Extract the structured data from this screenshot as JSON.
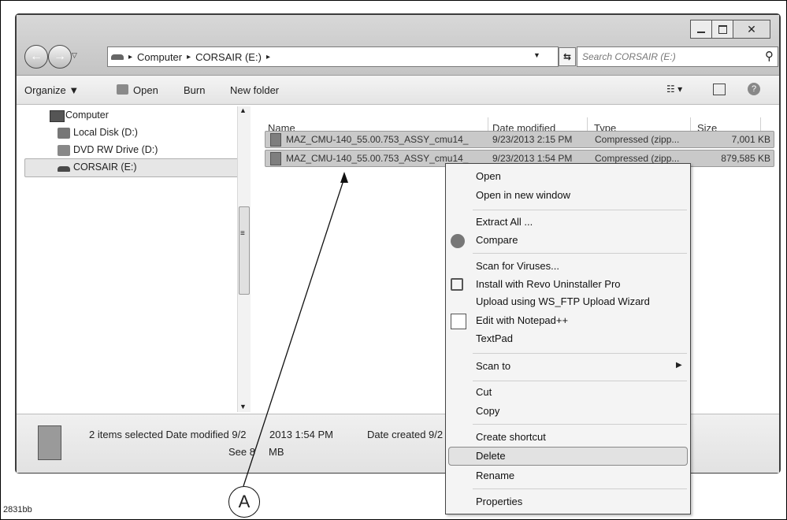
{
  "address": {
    "crumbs": [
      "Computer",
      "CORSAIR (E:)"
    ],
    "separators": [
      "▸",
      "▸",
      "▸"
    ]
  },
  "search": {
    "placeholder": "Search CORSAIR (E:)"
  },
  "toolbar": {
    "organize_label": "Organize ▼",
    "open_label": "Open",
    "burn_label": "Burn",
    "new_folder_label": "New folder"
  },
  "nav": {
    "items": [
      {
        "label": "Computer",
        "icon": "computer-icon"
      },
      {
        "label": "Local Disk  (D:)",
        "icon": "local-disk-icon"
      },
      {
        "label": "DVD RW Drive (D:)",
        "icon": "dvd-drive-icon"
      },
      {
        "label": "CORSAIR  (E:)",
        "icon": "usb-drive-icon",
        "selected": true
      }
    ]
  },
  "columns": [
    "Name",
    "Date modified",
    "Type",
    "Size"
  ],
  "files": [
    {
      "name": "MAZ_CMU-140_55.00.753_ASSY_cmu14_",
      "date": "9/23/2013 2:15 PM",
      "type": "Compressed (zipp...",
      "size": "7,001 KB"
    },
    {
      "name": "MAZ_CMU-140_55.00.753_ASSY_cmu14_",
      "date": "9/23/2013 1:54 PM",
      "type": "Compressed (zipp...",
      "size": "879,585 KB"
    }
  ],
  "status": {
    "line1": "2 items selected Date modified 9/2",
    "line1_rest": "2013 1:54 PM",
    "date_created": "Date created 9/2",
    "line2": "See 8",
    "line2_rest": "MB"
  },
  "context_menu": {
    "open": "Open",
    "open_new_window": "Open in new window",
    "extract_all": "Extract All ...",
    "compare": "Compare",
    "scan_viruses": "Scan for Viruses...",
    "revo": "Install with Revo Uninstaller Pro",
    "ws_ftp": "Upload using WS_FTP Upload Wizard",
    "notepad": "Edit with Notepad++",
    "textpad": "TextPad",
    "scan_to": "Scan to",
    "cut": "Cut",
    "copy": "Copy",
    "create_shortcut": "Create shortcut",
    "delete": "Delete",
    "rename": "Rename",
    "properties": "Properties"
  },
  "callout": {
    "label": "A"
  },
  "figure_label": "2831bb"
}
